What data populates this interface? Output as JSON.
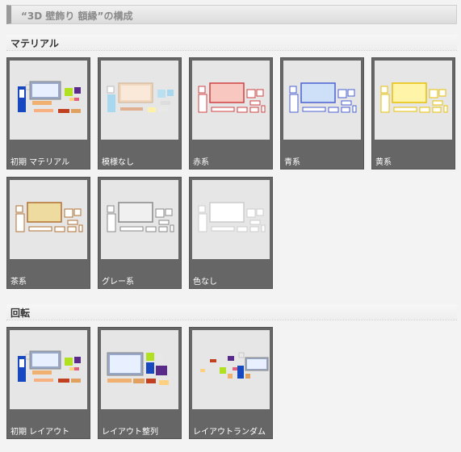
{
  "header": {
    "title": "“3D 壁飾り 額縁”の構成"
  },
  "sections": {
    "material": {
      "title": "マテリアル"
    },
    "rotation": {
      "title": "回転"
    }
  },
  "material_tiles": [
    {
      "label": "初期 マテリアル",
      "style": "colorful"
    },
    {
      "label": "模様なし",
      "style": "pastel"
    },
    {
      "label": "赤系",
      "color": "#d04040",
      "fill": "#f8c8c0"
    },
    {
      "label": "青系",
      "color": "#4a60d0",
      "fill": "#cde0f8"
    },
    {
      "label": "黄系",
      "color": "#e8c000",
      "fill": "#fff4a8"
    },
    {
      "label": "茶系",
      "color": "#b07030",
      "fill": "#eedba0"
    },
    {
      "label": "グレー系",
      "color": "#888888",
      "fill": "#f0f0f0"
    },
    {
      "label": "色なし",
      "color": "#cccccc",
      "fill": "#ffffff"
    }
  ],
  "rotation_tiles": [
    {
      "label": "初期 レイアウト"
    },
    {
      "label": "レイアウト整列"
    },
    {
      "label": "レイアウトランダム"
    }
  ],
  "colors": {
    "tile_bg": "#666666",
    "thumb_bg": "#e6e6e6",
    "label_text": "#ffffff"
  }
}
